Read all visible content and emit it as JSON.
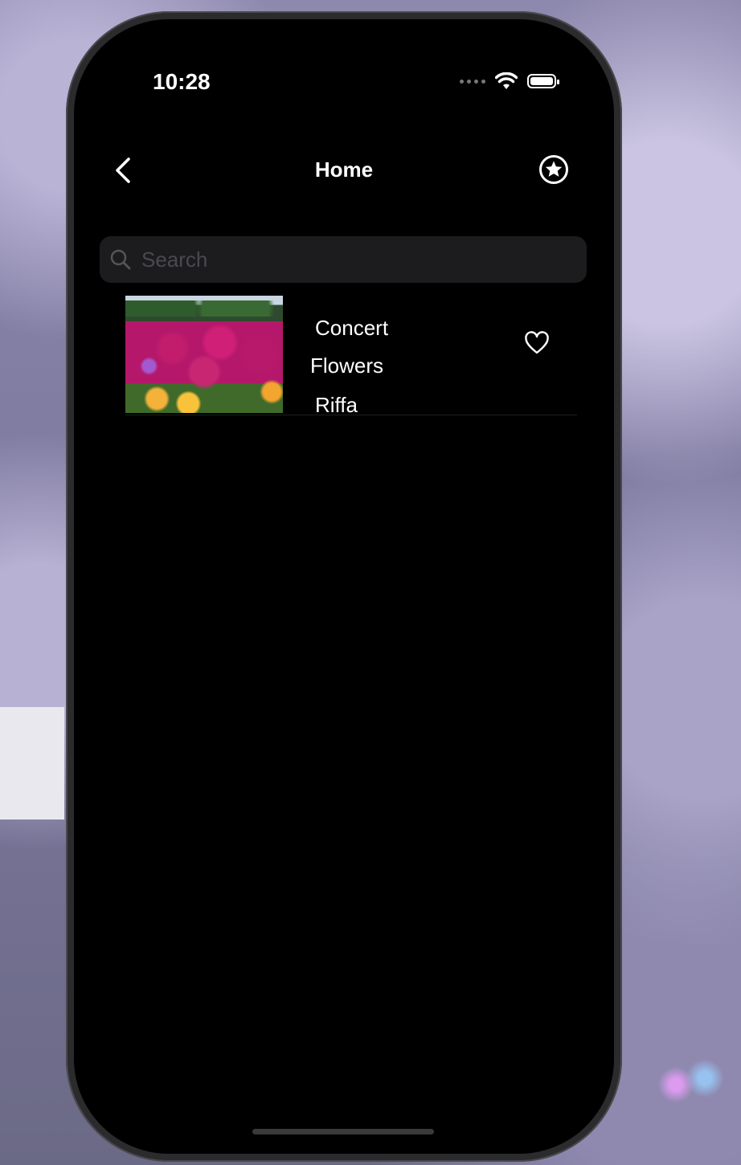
{
  "status_bar": {
    "time": "10:28"
  },
  "nav": {
    "title": "Home"
  },
  "search": {
    "placeholder": "Search"
  },
  "items": [
    {
      "line1": "Concert",
      "line2": "Flowers",
      "line3": "Riffa"
    }
  ]
}
